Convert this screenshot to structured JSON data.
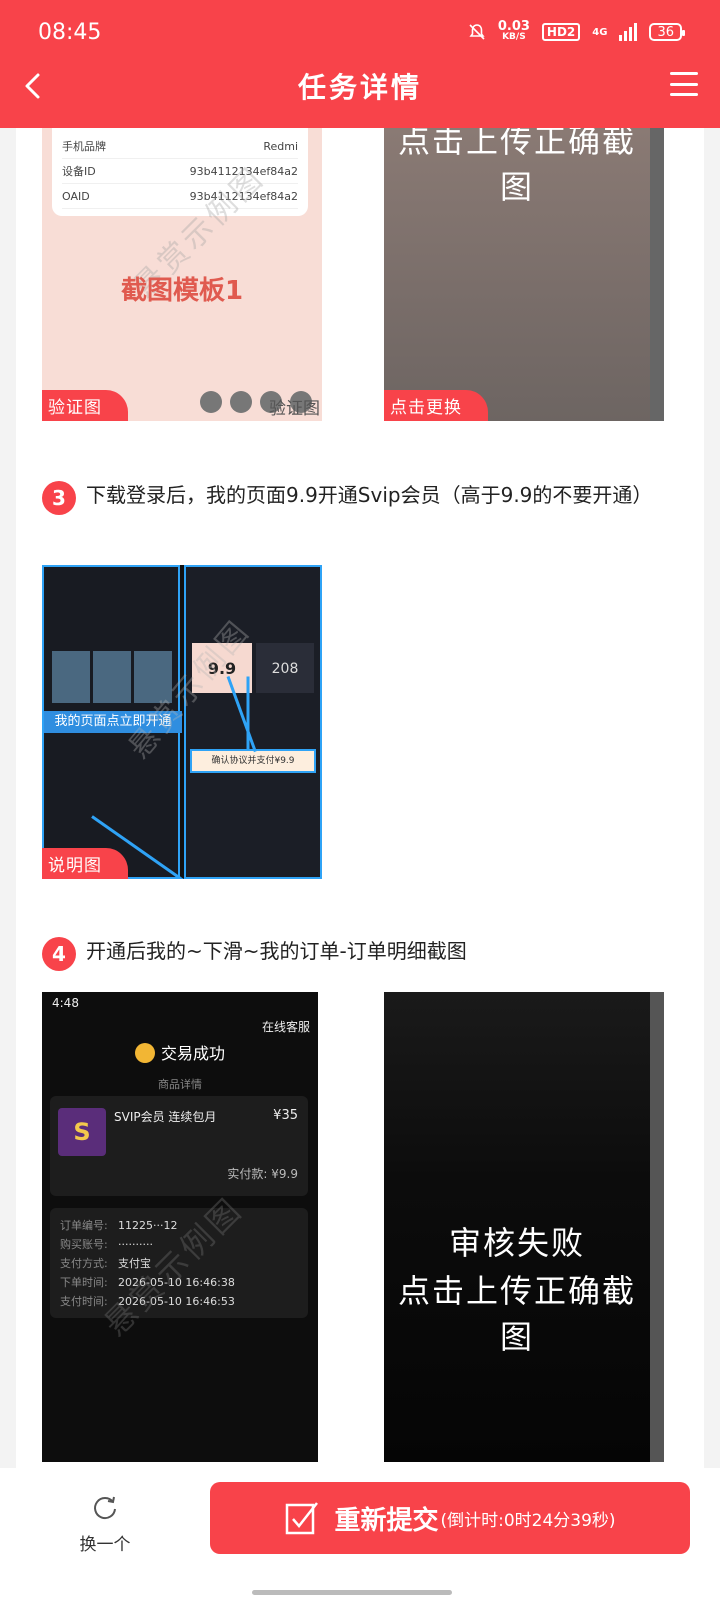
{
  "status_bar": {
    "time": "08:45",
    "net_speed_value": "0.03",
    "net_speed_unit": "KB/S",
    "hd_badge": "HD2",
    "network": "4G",
    "battery": "36"
  },
  "header": {
    "title": "任务详情"
  },
  "step2_images": {
    "template": {
      "fields": [
        {
          "label": "手机品牌",
          "value": "Redmi"
        },
        {
          "label": "设备ID",
          "value": "93b4112134ef84a2"
        },
        {
          "label": "OAID",
          "value": "93b4112134ef84a2"
        }
      ],
      "caption": "截图模板1",
      "watermark": "悬赏示例图",
      "tag": "验证图",
      "corner_label": "验证图"
    },
    "upload": {
      "text": "点击上传正确截图",
      "tag": "点击更换"
    }
  },
  "step3": {
    "number": "3",
    "text": "下载登录后，我的页面9.9开通Svip会员（高于9.9的不要开通）",
    "image": {
      "banner": "我的页面点立即开通",
      "vip_price": "9.9",
      "vip_alt": "208",
      "confirm": "确认协议并支付¥9.9",
      "watermark": "悬赏示例图",
      "tag": "说明图"
    }
  },
  "step4": {
    "number": "4",
    "text": "开通后我的~下滑~我的订单-订单明细截图",
    "example": {
      "time": "4:48",
      "service": "在线客服",
      "success": "交易成功",
      "section": "商品详情",
      "goods_icon": "S",
      "goods_name": "SVIP会员 连续包月",
      "goods_price": "¥35",
      "paid": "实付款: ¥9.9",
      "info": [
        {
          "k": "订单编号:",
          "v": "11225···12"
        },
        {
          "k": "购买账号:",
          "v": "··········"
        },
        {
          "k": "支付方式:",
          "v": "支付宝"
        },
        {
          "k": "下单时间:",
          "v": "2026-05-10 16:46:38"
        },
        {
          "k": "支付时间:",
          "v": "2026-05-10 16:46:53"
        }
      ],
      "watermark": "悬赏示例图"
    },
    "upload": {
      "status": "审核失败",
      "text": "点击上传正确截图"
    }
  },
  "bottom": {
    "swap_label": "换一个",
    "resubmit_label": "重新提交",
    "countdown": "(倒计时:0时24分39秒)"
  },
  "colors": {
    "brand": "#f8434a",
    "explain_border": "#2fa3f6"
  }
}
